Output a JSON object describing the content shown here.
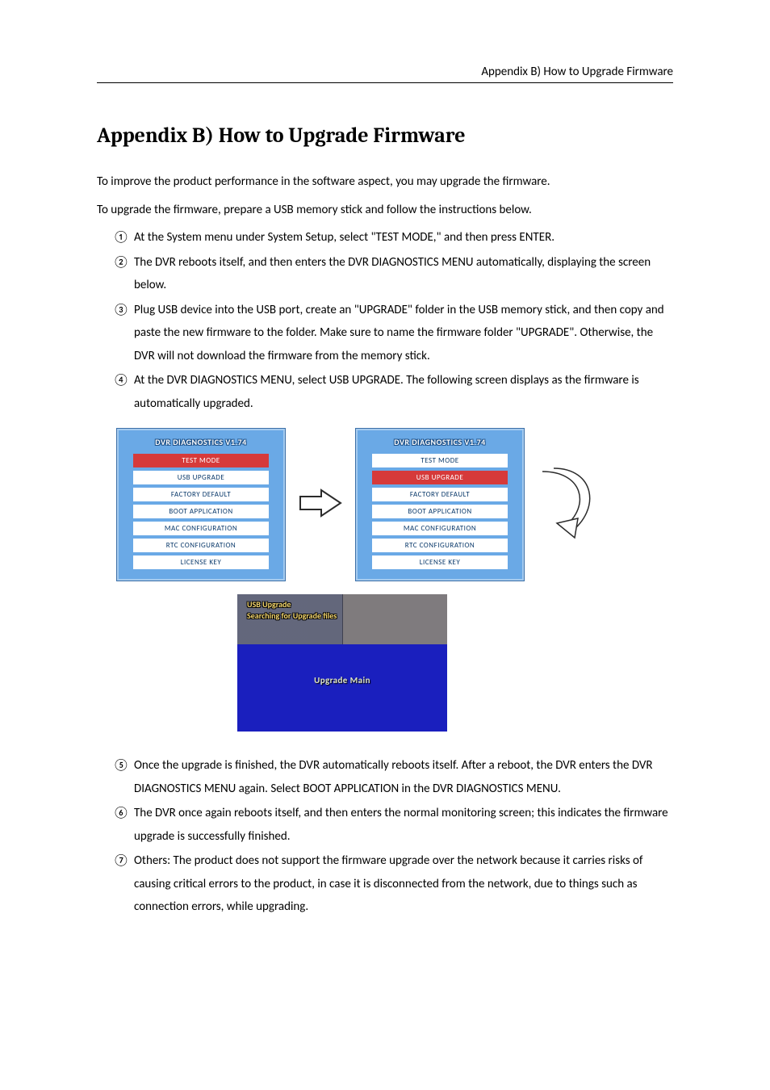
{
  "header": {
    "running_head": "Appendix B) How to Upgrade Firmware"
  },
  "title": "Appendix B) How to Upgrade Firmware",
  "intro": [
    "To improve the product performance in the software aspect, you may upgrade the firmware.",
    "To upgrade the firmware, prepare a USB memory stick and follow the instructions below."
  ],
  "steps_top": [
    {
      "marker": "①",
      "text": "At the System menu under System Setup, select \"TEST MODE,\" and then press ENTER."
    },
    {
      "marker": "②",
      "text": "The DVR reboots itself, and then enters the DVR DIAGNOSTICS MENU automatically, displaying the screen below."
    },
    {
      "marker": "③",
      "text": "Plug USB device into the USB port, create an \"UPGRADE\" folder in the USB memory stick, and then copy and paste the new firmware to the folder. Make sure to name the firmware folder \"UPGRADE\". Otherwise, the DVR will not download the firmware from the memory stick."
    },
    {
      "marker": "④",
      "text": "At the DVR DIAGNOSTICS MENU, select USB UPGRADE. The following screen displays as the firmware is automatically upgraded."
    }
  ],
  "diag": {
    "title": "DVR DIAGNOSTICS V1.74",
    "items": [
      "TEST MODE",
      "USB UPGRADE",
      "FACTORY DEFAULT",
      "BOOT APPLICATION",
      "MAC CONFIGURATION",
      "RTC CONFIGURATION",
      "LICENSE KEY"
    ],
    "left_selected_index": 0,
    "right_selected_index": 1
  },
  "upgrade_screen": {
    "overlay_title": "USB Upgrade",
    "overlay_status": "Searching for Upgrade files",
    "center_label": "Upgrade Main"
  },
  "steps_bottom": [
    {
      "marker": "⑤",
      "text": "Once the upgrade is finished, the DVR automatically reboots itself. After a reboot, the DVR enters the DVR DIAGNOSTICS MENU again. Select BOOT APPLICATION in the DVR DIAGNOSTICS MENU."
    },
    {
      "marker": "⑥",
      "text": "The DVR once again reboots itself, and then enters the normal monitoring screen; this indicates the firmware upgrade is successfully finished."
    },
    {
      "marker": "⑦",
      "text": "Others: The product does not support the firmware upgrade over the network because it carries risks of causing critical errors to the product, in case it is disconnected from the network, due to things such as connection errors, while upgrading."
    }
  ]
}
